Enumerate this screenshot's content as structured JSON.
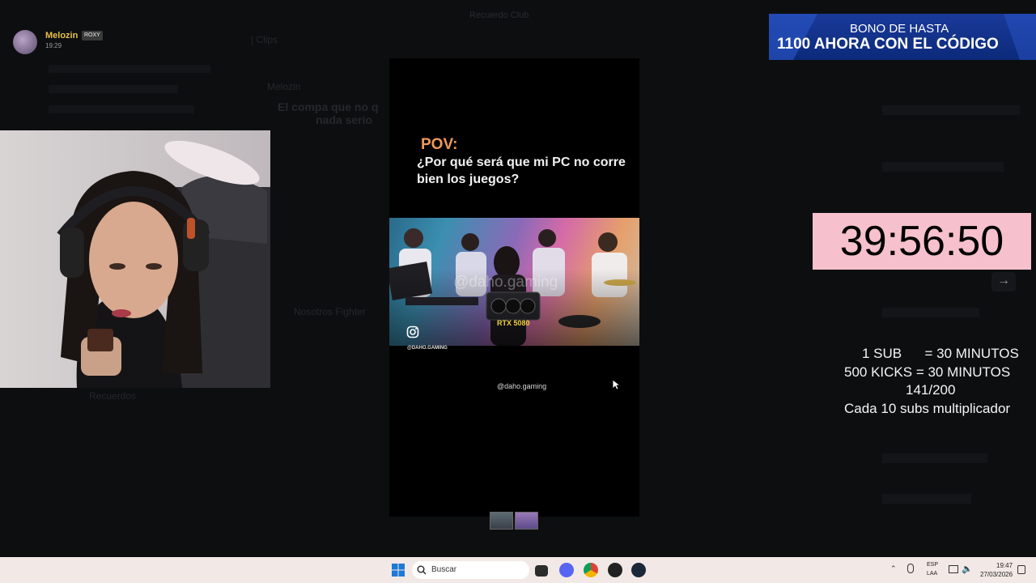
{
  "window": {
    "title": "Recuerdo Club"
  },
  "stream_overlay": {
    "streamer_name": "Melozin",
    "streamer_badge": "ROXY",
    "streamer_time": "19:29",
    "bonus_line1": "BONO DE HASTA",
    "bonus_line2": "1100 AHORA CON EL CÓDIGO",
    "timer": "39:56:50",
    "rules": {
      "line1": "1 SUB      = 30 MINUTOS",
      "line2": "500 KICKS = 30 MINUTOS",
      "line3": "141/200",
      "line4": "Cada 10 subs multiplicador"
    }
  },
  "lightbox": {
    "pov_title": "POV:",
    "pov_text": "¿Por qué será que mi PC no corre bien los juegos?",
    "watermark": "@daho.gaming",
    "gpu_label": "RTX 5080",
    "video_handle": "@DAHO.GAMING",
    "handle": "@daho.gaming",
    "next_arrow": "→"
  },
  "discord_bg": {
    "channel_name": "| Clips",
    "message_author": "Melozin",
    "message_text_1": "El compa que no q",
    "message_text_2": "nada serio",
    "embed_caption": "Nosotros Fighter",
    "sidebar_item": "Recuerdos"
  },
  "taskbar": {
    "search_placeholder": "Buscar",
    "lang1": "ESP",
    "lang2": "LAA",
    "time": "19:47",
    "date": "27/03/2026"
  },
  "colors": {
    "timer_bg": "#f6c1cc",
    "banner_bg": "#1a3a9a",
    "pov_accent": "#f09a5a",
    "taskbar_bg": "#f2e9e6"
  }
}
